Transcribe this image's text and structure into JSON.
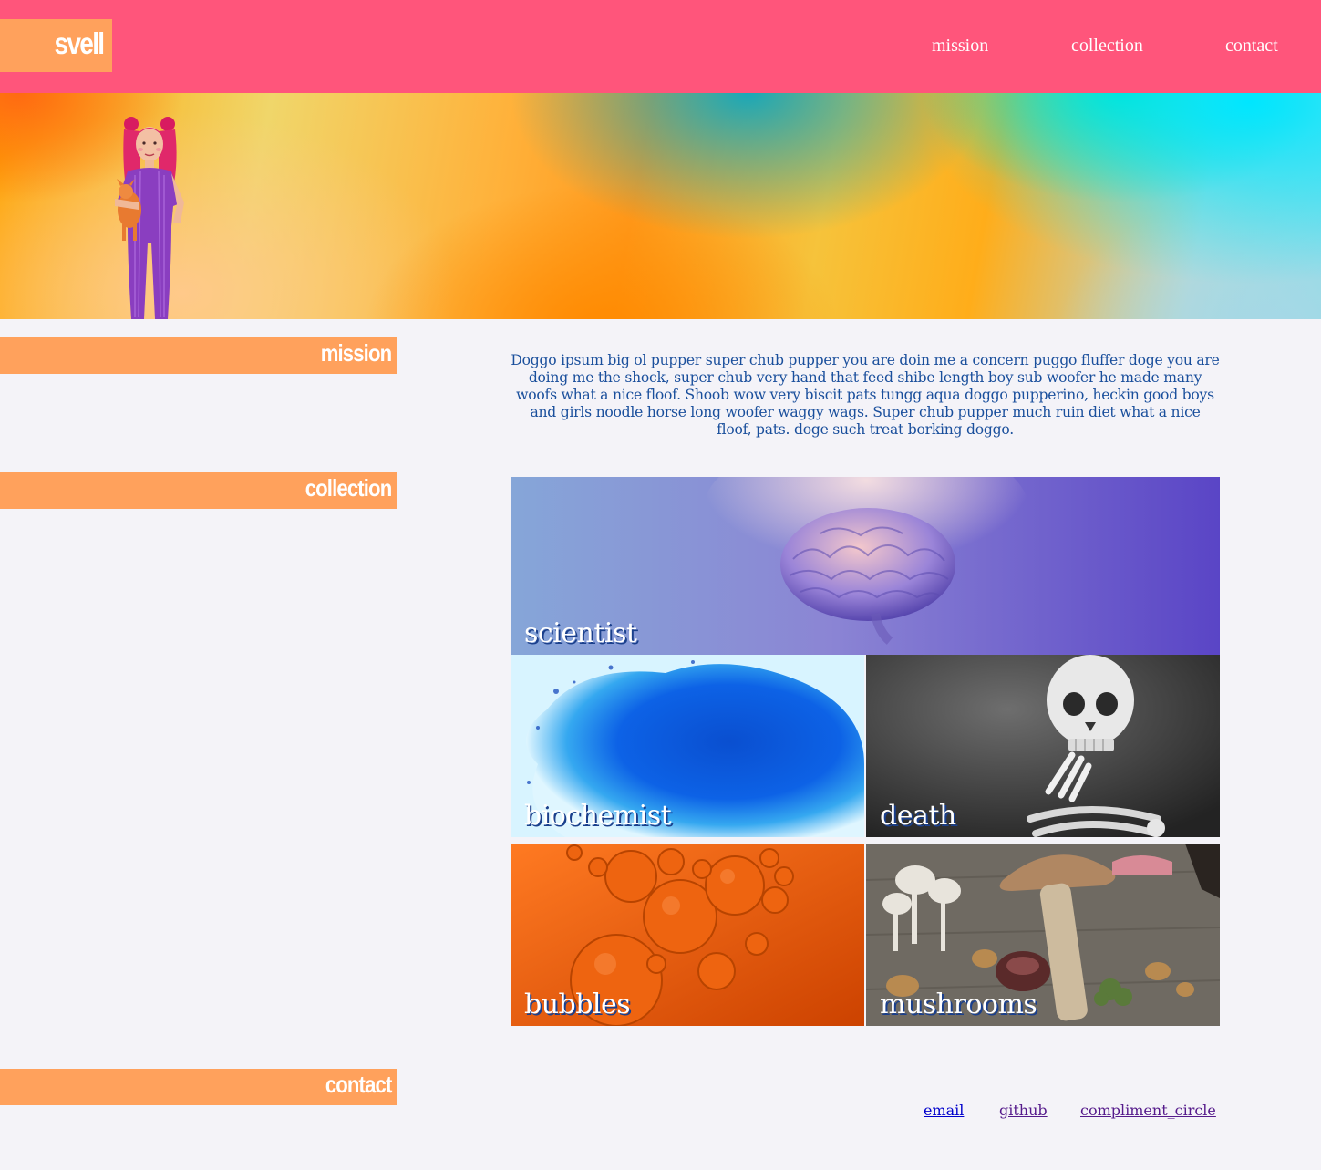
{
  "header": {
    "logo": "svell",
    "nav": [
      {
        "label": "mission"
      },
      {
        "label": "collection"
      },
      {
        "label": "contact"
      }
    ]
  },
  "sections": {
    "mission": {
      "title": "mission",
      "text": "Doggo ipsum big ol pupper super chub pupper you are doin me a concern puggo fluffer doge you are doing me the shock, super chub very hand that feed shibe length boy sub woofer he made many woofs what a nice floof. Shoob wow very biscit pats tungg aqua doggo pupperino, heckin good boys and girls noodle horse long woofer waggy wags. Super chub pupper much ruin diet what a nice floof, pats. doge such treat borking doggo."
    },
    "collection": {
      "title": "collection",
      "items": [
        {
          "label": "scientist",
          "icon": "brain-image"
        },
        {
          "label": "biochemist",
          "icon": "blue-ink-image"
        },
        {
          "label": "death",
          "icon": "skeleton-image"
        },
        {
          "label": "bubbles",
          "icon": "orange-bubbles-image"
        },
        {
          "label": "mushrooms",
          "icon": "mushrooms-image"
        }
      ]
    },
    "contact": {
      "title": "contact",
      "links": [
        {
          "label": "email",
          "color": "#0000cc"
        },
        {
          "label": "github",
          "color": "#551a8b"
        },
        {
          "label": "compliment_circle",
          "color": "#551a8b"
        }
      ]
    }
  },
  "colors": {
    "header": "#ff557b",
    "accent": "#ffa15c",
    "background": "#f4f3f8",
    "mission_text": "#1a4f9c"
  }
}
